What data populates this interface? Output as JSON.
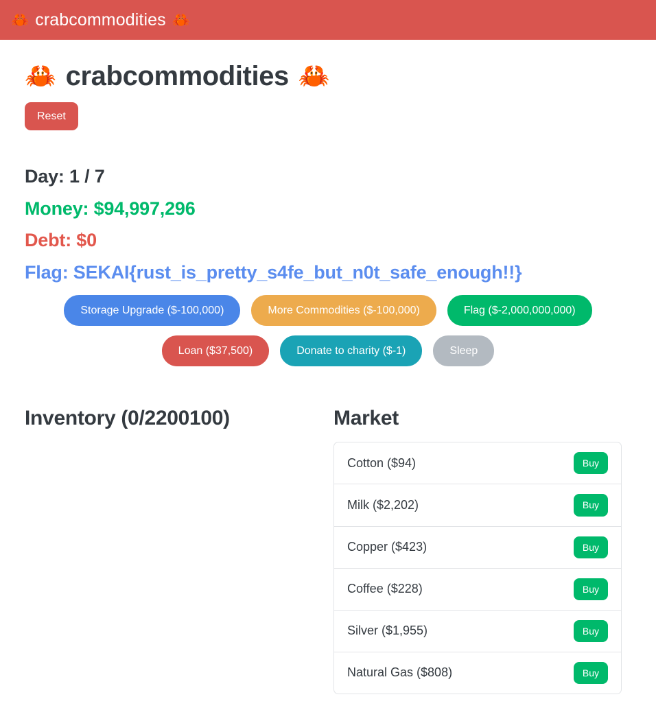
{
  "navbar": {
    "brand": "crabcommodities",
    "crab_icon": "crab-emoji",
    "background": "#d9554f"
  },
  "header": {
    "title": "crabcommodities",
    "reset_label": "Reset"
  },
  "stats": {
    "day": "Day: 1 / 7",
    "money": "Money: $94,997,296",
    "debt": "Debt: $0",
    "flag": "Flag: SEKAI{rust_is_pretty_s4fe_but_n0t_safe_enough!!}",
    "colors": {
      "day": "#343a40",
      "money": "#00b96b",
      "debt": "#e2574c",
      "flag": "#5b8def"
    }
  },
  "actions": [
    {
      "label": "Storage Upgrade ($-100,000)",
      "style": "act-blue",
      "name": "storage-upgrade-button",
      "disabled": false
    },
    {
      "label": "More Commodities ($-100,000)",
      "style": "act-orange",
      "name": "more-commodities-button",
      "disabled": false
    },
    {
      "label": "Flag ($-2,000,000,000)",
      "style": "act-green",
      "name": "flag-button",
      "disabled": false
    },
    {
      "label": "Loan ($37,500)",
      "style": "act-red",
      "name": "loan-button",
      "disabled": false
    },
    {
      "label": "Donate to charity ($-1)",
      "style": "act-teal",
      "name": "donate-button",
      "disabled": false
    },
    {
      "label": "Sleep",
      "style": "act-gray",
      "name": "sleep-button",
      "disabled": true
    }
  ],
  "inventory": {
    "title": "Inventory (0/2200100)",
    "items": []
  },
  "market": {
    "title": "Market",
    "buy_label": "Buy",
    "items": [
      {
        "label": "Cotton ($94)",
        "name": "Cotton",
        "price": 94
      },
      {
        "label": "Milk ($2,202)",
        "name": "Milk",
        "price": 2202
      },
      {
        "label": "Copper ($423)",
        "name": "Copper",
        "price": 423
      },
      {
        "label": "Coffee ($228)",
        "name": "Coffee",
        "price": 228
      },
      {
        "label": "Silver ($1,955)",
        "name": "Silver",
        "price": 1955
      },
      {
        "label": "Natural Gas ($808)",
        "name": "Natural Gas",
        "price": 808
      }
    ]
  }
}
